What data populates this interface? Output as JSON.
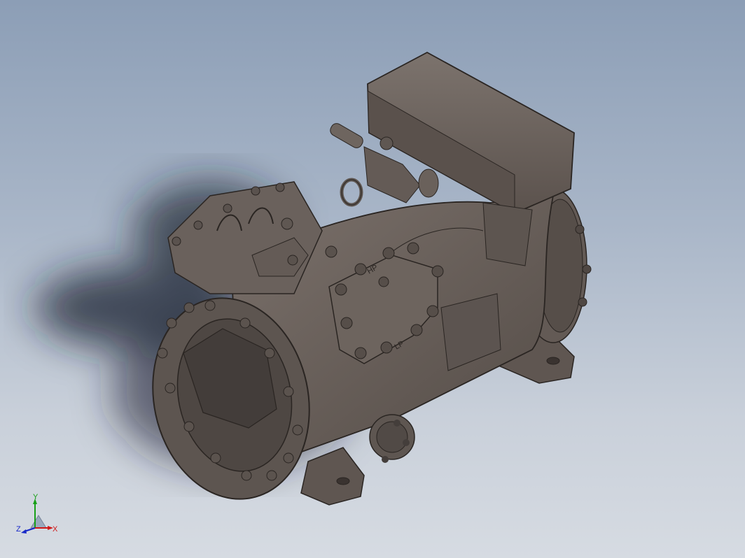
{
  "viewport": {
    "model": "compressor-assembly",
    "background": {
      "top": "#8c9eb6",
      "bottom": "#d6dbe2"
    },
    "body_color": "#6b625d",
    "edge_color": "#2a2522"
  },
  "part_labels": {
    "high_pressure": "HP",
    "low_pressure": "LP"
  },
  "triad": {
    "x_label": "X",
    "y_label": "Y",
    "z_label": "Z",
    "x_color": "#d01818",
    "y_color": "#18a018",
    "z_color": "#1828c8"
  }
}
